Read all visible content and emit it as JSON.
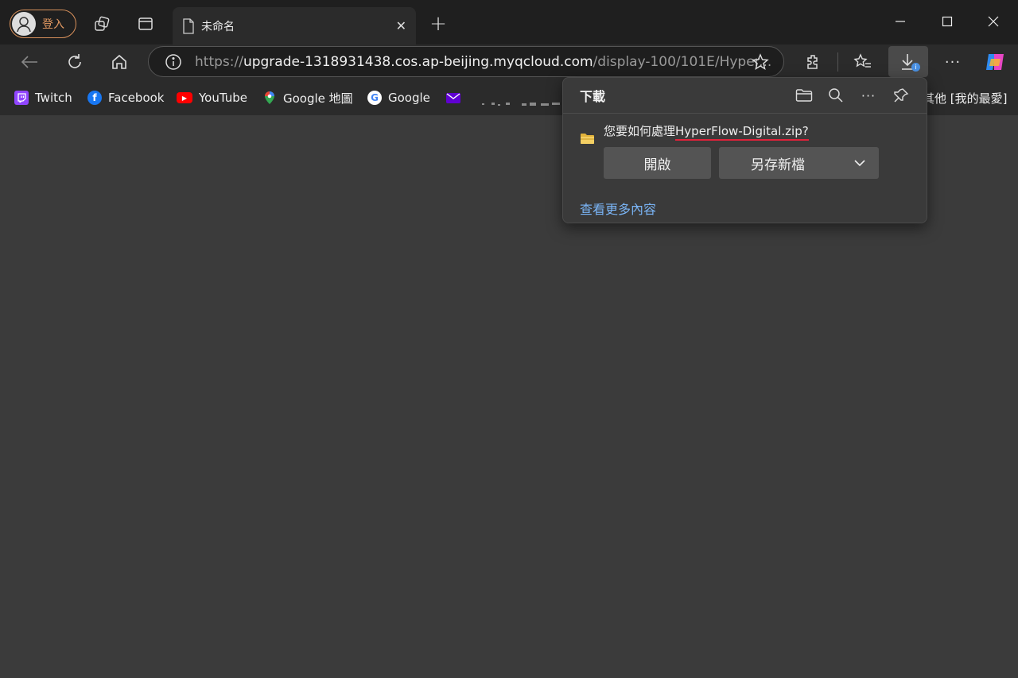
{
  "profile": {
    "label": "登入"
  },
  "tab": {
    "title": "未命名"
  },
  "address": {
    "scheme": "https://",
    "host": "upgrade-1318931438.cos.ap-beijing.myqcloud.com",
    "path": "/display-100/101E/Hyper..."
  },
  "bookmarks": [
    {
      "label": "Twitch",
      "icon": "twitch-icon",
      "color": "#9146ff"
    },
    {
      "label": "Facebook",
      "icon": "facebook-icon",
      "color": "#1877f2"
    },
    {
      "label": "YouTube",
      "icon": "youtube-icon",
      "color": "#ff0000"
    },
    {
      "label": "Google 地圖",
      "icon": "google-maps-icon",
      "color": "#34a853"
    },
    {
      "label": "Google",
      "icon": "google-icon",
      "color": "#ffffff"
    }
  ],
  "bookmarks_other": "其他 [我的最愛]",
  "download_panel": {
    "title": "下載",
    "question_prefix": "您要如何處理",
    "filename": "HyperFlow-Digital.zip?",
    "open_label": "開啟",
    "save_as_label": "另存新檔",
    "more_link": "查看更多內容"
  },
  "colors": {
    "accent_orange": "#e49a62",
    "link": "#7ab4f5",
    "underline": "#e0223a"
  }
}
